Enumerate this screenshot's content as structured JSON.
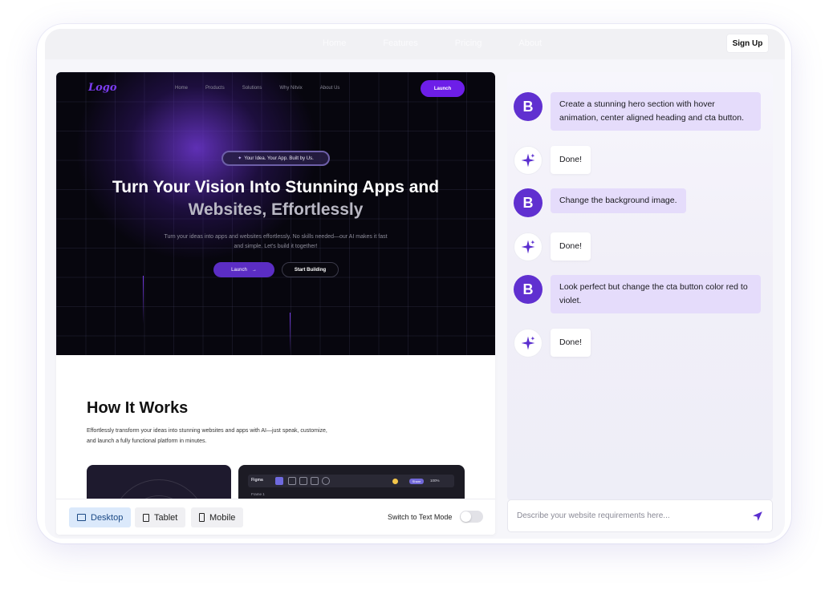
{
  "topbar": {
    "nav": [
      "Home",
      "Features",
      "Pricing",
      "About"
    ],
    "signup_label": "Sign Up"
  },
  "preview": {
    "hero": {
      "logo": "Logo",
      "nav": [
        "Home",
        "Products",
        "Solutions",
        "Why Nitvix",
        "About Us"
      ],
      "launch_label": "Launch",
      "pill_text": "Your Idea. Your App. Built by Us.",
      "headline_line1": "Turn Your Vision Into Stunning Apps and",
      "headline_line2": "Websites, Effortlessly",
      "subtext": "Turn your ideas into apps and websites effortlessly. No skills needed—our AI makes it fast and simple. Let's build it together!",
      "primary_button": "Launch",
      "secondary_button": "Start Building"
    },
    "how": {
      "title": "How It Works",
      "description": "Effortlessly transform your ideas into stunning websites and apps with AI—just speak, customize, and launch a fully functional platform in minutes."
    },
    "figma_card": {
      "app_label": "Figma",
      "frame_label": "Frame 1",
      "share_label": "Share",
      "zoom_label": "100%"
    },
    "devices": [
      "Desktop",
      "Tablet",
      "Mobile"
    ],
    "active_device": "Desktop",
    "toggle_label": "Switch to Text Mode",
    "toggle_on": false
  },
  "chat": {
    "messages": [
      {
        "role": "user",
        "avatar": "B",
        "text": "Create a stunning hero section with hover animation, center aligned heading and cta button."
      },
      {
        "role": "ai",
        "text": "Done!"
      },
      {
        "role": "user",
        "avatar": "B",
        "text": "Change the background image."
      },
      {
        "role": "ai",
        "text": "Done!"
      },
      {
        "role": "user",
        "avatar": "B",
        "text": "Look perfect but change the cta button color red to violet."
      },
      {
        "role": "ai",
        "text": "Done!"
      }
    ],
    "input_placeholder": "Describe your website requirements here..."
  },
  "colors": {
    "accent": "#6030d0",
    "hero_bg": "#07060e",
    "user_bubble": "#e5dcfb",
    "active_device_bg": "#dbe9fb"
  }
}
